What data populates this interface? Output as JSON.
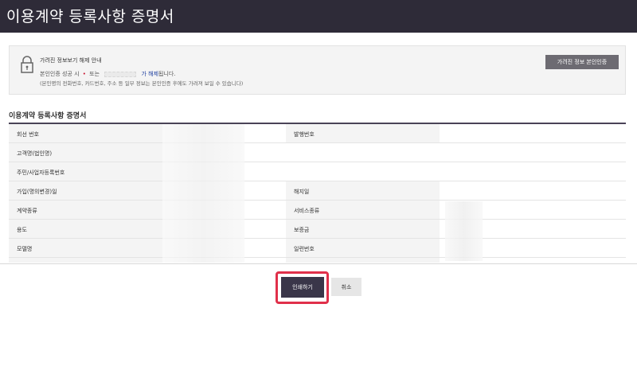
{
  "header": {
    "title": "이용계약 등록사항 증명서"
  },
  "notice": {
    "title": "가려진 정보보기 해제 안내",
    "line1_prefix": "본인인증 성공 시",
    "line1_or": "또는",
    "line1_link": "가 해제",
    "line1_suffix": "됩니다.",
    "line2": "(본인명의 전화번호, 카드번호, 주소 등 일부 정보는 본인인증 후에도 가려져 보일 수 있습니다)",
    "auth_button": "가려진 정보 본인인증"
  },
  "section": {
    "title": "이용계약 등록사항 증명서"
  },
  "table": {
    "rows": [
      {
        "label1": "회선 번호",
        "label2": "발행번호"
      },
      {
        "label1": "고객명(법인명)",
        "label2": ""
      },
      {
        "label1": "주민/사업자등록번호",
        "label2": ""
      },
      {
        "label1": "가입(명의변경)일",
        "label2": "해지일"
      },
      {
        "label1": "계약종류",
        "label2": "서비스종류"
      },
      {
        "label1": "용도",
        "label2": "보증금"
      },
      {
        "label1": "모델명",
        "label2": "일련번호"
      },
      {
        "label1": "",
        "label2": ""
      }
    ]
  },
  "actions": {
    "print": "인쇄하기",
    "cancel": "취소"
  },
  "colors": {
    "header_bg": "#2e2b38",
    "highlight": "#e0304a",
    "print_bg": "#3a3649"
  }
}
